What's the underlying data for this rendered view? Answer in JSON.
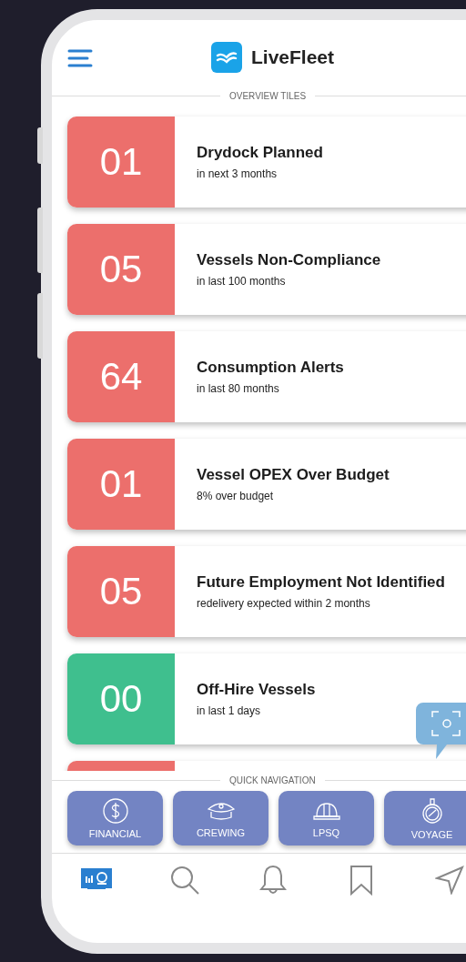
{
  "app": {
    "title": "LiveFleet"
  },
  "overview": {
    "label": "OVERVIEW TILES",
    "tiles": [
      {
        "number": "01",
        "title": "Drydock Planned",
        "subtitle": "in next 3 months",
        "color": "#ec6f6c"
      },
      {
        "number": "05",
        "title": "Vessels Non-Compliance",
        "subtitle": "in last 100 months",
        "color": "#ec6f6c"
      },
      {
        "number": "64",
        "title": "Consumption Alerts",
        "subtitle": "in last 80 months",
        "color": "#ec6f6c"
      },
      {
        "number": "01",
        "title": "Vessel OPEX Over Budget",
        "subtitle": "8% over budget",
        "color": "#ec6f6c"
      },
      {
        "number": "05",
        "title": "Future Employment Not Identified",
        "subtitle": "redelivery expected within 2 months",
        "color": "#ec6f6c"
      },
      {
        "number": "00",
        "title": "Off-Hire Vessels",
        "subtitle": "in last 1 days",
        "color": "#3fbf8e"
      }
    ],
    "peek_tile": {
      "color": "#ec6f6c"
    }
  },
  "quick_navigation": {
    "label": "QUICK NAVIGATION",
    "buttons": [
      "FINANCIAL",
      "CREWING",
      "LPSQ",
      "VOYAGE"
    ]
  },
  "bottom_nav": [
    {
      "selected": true
    },
    {
      "selected": false
    },
    {
      "selected": false
    },
    {
      "selected": false
    },
    {
      "selected": false
    }
  ]
}
